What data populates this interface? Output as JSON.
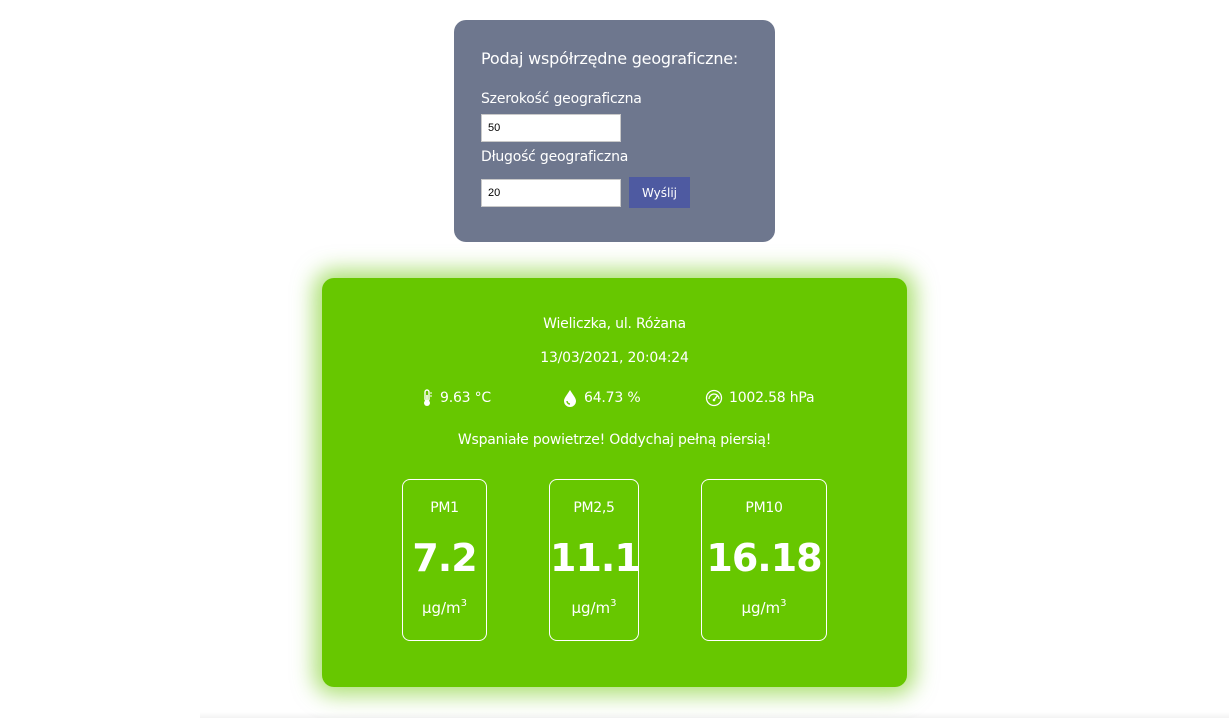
{
  "form": {
    "title": "Podaj współrzędne geograficzne:",
    "latitude_label": "Szerokość geograficzna",
    "latitude_value": "50",
    "longitude_label": "Długość geograficzna",
    "longitude_value": "20",
    "submit_label": "Wyślij"
  },
  "air": {
    "location": "Wieliczka, ul. Różana",
    "datetime": "13/03/2021, 20:04:24",
    "temperature": "9.63 °C",
    "humidity": "64.73 %",
    "pressure": "1002.58 hPa",
    "message": "Wspaniałe powietrze! Oddychaj pełną piersią!",
    "pm": [
      {
        "label": "PM1",
        "value": "7.2",
        "unit": "μg/m",
        "unit_sup": "3"
      },
      {
        "label": "PM2,5",
        "value": "11.1",
        "unit": "μg/m",
        "unit_sup": "3"
      },
      {
        "label": "PM10",
        "value": "16.18",
        "unit": "μg/m",
        "unit_sup": "3"
      }
    ]
  },
  "colors": {
    "form_background": "#6e778e",
    "submit_button": "#4e5aa1",
    "air_quality_good": "#67c700"
  },
  "icons": {
    "temperature": "thermometer-icon",
    "humidity": "droplet-icon",
    "pressure": "gauge-icon"
  }
}
